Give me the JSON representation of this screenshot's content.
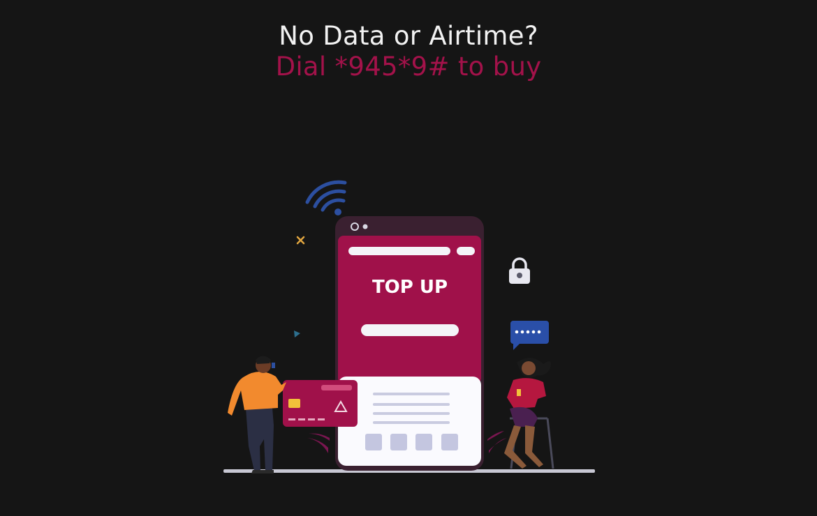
{
  "headline": {
    "line1": "No Data or Airtime?",
    "line2": "Dial *945*9# to buy"
  },
  "phone": {
    "top_up_label": "TOP UP"
  },
  "icons": {
    "wifi": "wifi-icon",
    "lock": "lock-icon",
    "chat_bubble": "chat-bubble-icon",
    "credit_card": "credit-card-icon"
  },
  "colors": {
    "background": "#151515",
    "accent": "#a3124a",
    "phone_header": "#3a2030",
    "wifi": "#2c4fa0",
    "person_left_shirt": "#f28a2e",
    "person_right_top": "#b5173f"
  }
}
